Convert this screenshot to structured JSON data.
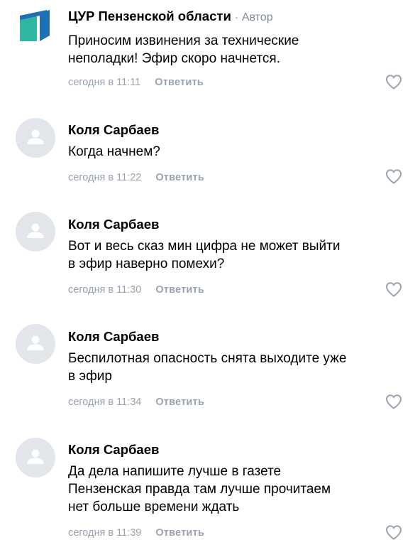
{
  "comments": [
    {
      "author": "ЦУР Пензенской области",
      "author_separator": "·",
      "author_tag": "Автор",
      "text": "Приносим извинения за технические\nнеполадки! Эфир скоро начнется.",
      "time": "сегодня в 11:11",
      "reply_label": "Ответить",
      "avatar_icon": "cur-logo-icon"
    },
    {
      "author": "Коля Сарбаев",
      "text": "Когда начнем?",
      "time": "сегодня в 11:22",
      "reply_label": "Ответить",
      "avatar_icon": "default-user-icon"
    },
    {
      "author": "Коля Сарбаев",
      "text": "Вот и весь сказ мин цифра не может выйти\nв эфир наверно помехи?",
      "time": "сегодня в 11:30",
      "reply_label": "Ответить",
      "avatar_icon": "default-user-icon"
    },
    {
      "author": "Коля Сарбаев",
      "text": "Беспилотная опасность снята выходите уже\nв эфир",
      "time": "сегодня в 11:34",
      "reply_label": "Ответить",
      "avatar_icon": "default-user-icon"
    },
    {
      "author": "Коля Сарбаев",
      "text": "Да дела напишите лучше в газете\nПензенская правда там лучше прочитаем\nнет больше времени ждать",
      "time": "сегодня в 11:39",
      "reply_label": "Ответить",
      "avatar_icon": "default-user-icon"
    }
  ],
  "like_icon": "heart-outline-icon",
  "colors": {
    "logo_dark": "#1f6fb5",
    "logo_light": "#2fb6a0",
    "muted": "#99a2ad",
    "avatar_bg": "#e2e5ea",
    "avatar_fg": "#ffffff"
  }
}
